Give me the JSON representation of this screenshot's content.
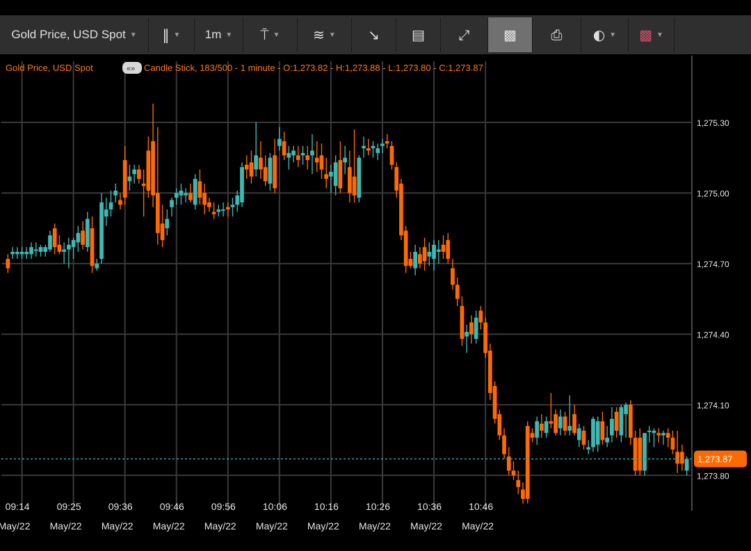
{
  "toolbar": {
    "instrument_label": "Gold Price, USD Spot",
    "interval_label": "1m",
    "icons": [
      "candle-type-icon",
      "chart-type-icon",
      "indicators-icon",
      "compare-icon",
      "drawing-icon",
      "fullscreen-icon",
      "bar-chart-icon",
      "print-icon",
      "theme-icon",
      "flag-icon"
    ]
  },
  "colors": {
    "up": "#3fb8b4",
    "down": "#ff6a00",
    "info_text": "#ff7a1a",
    "grid": "#3a3a3a",
    "axis_text": "#e6e6e6",
    "price_badge": "#ff6a00",
    "price_line": "#2fa3a6"
  },
  "info_line": {
    "name": "Gold Price, USD Spot",
    "badge": "«»",
    "details": "Candle Stick, 183/500 - 1 minute - O:1,273.82 - H:1,273.88 - L:1,273.80 - C:1,273.87"
  },
  "last_price_label": "1,273.87",
  "chart_data": {
    "type": "candlestick",
    "ylim": [
      1273.65,
      1275.56
    ],
    "y_ticks": [
      1275.3,
      1275.0,
      1274.7,
      1274.4,
      1274.1,
      1273.8
    ],
    "y_tick_labels": [
      "1,275.30",
      "1,275.00",
      "1,274.70",
      "1,274.40",
      "1,274.10",
      "1,273.80"
    ],
    "x_ticks": [
      {
        "index": 3,
        "time": "09:14",
        "date": "May/22"
      },
      {
        "index": 14,
        "time": "09:25",
        "date": "May/22"
      },
      {
        "index": 25,
        "time": "09:36",
        "date": "May/22"
      },
      {
        "index": 36,
        "time": "09:46",
        "date": "May/22"
      },
      {
        "index": 47,
        "time": "09:56",
        "date": "May/22"
      },
      {
        "index": 58,
        "time": "10:06",
        "date": "May/22"
      },
      {
        "index": 69,
        "time": "10:16",
        "date": "May/22"
      },
      {
        "index": 80,
        "time": "10:26",
        "date": "May/22"
      },
      {
        "index": 91,
        "time": "10:36",
        "date": "May/22"
      },
      {
        "index": 102,
        "time": "10:46",
        "date": "May/22"
      }
    ],
    "last_price": 1273.87,
    "ohlc": [
      [
        1274.72,
        1274.74,
        1274.66,
        1274.68
      ],
      [
        1274.74,
        1274.77,
        1274.72,
        1274.75
      ],
      [
        1274.74,
        1274.77,
        1274.72,
        1274.75
      ],
      [
        1274.74,
        1274.77,
        1274.72,
        1274.75
      ],
      [
        1274.74,
        1274.77,
        1274.72,
        1274.75
      ],
      [
        1274.74,
        1274.79,
        1274.72,
        1274.77
      ],
      [
        1274.76,
        1274.79,
        1274.73,
        1274.76
      ],
      [
        1274.75,
        1274.78,
        1274.73,
        1274.77
      ],
      [
        1274.75,
        1274.78,
        1274.73,
        1274.77
      ],
      [
        1274.76,
        1274.84,
        1274.75,
        1274.82
      ],
      [
        1274.85,
        1274.87,
        1274.74,
        1274.77
      ],
      [
        1274.78,
        1274.82,
        1274.74,
        1274.75
      ],
      [
        1274.75,
        1274.79,
        1274.7,
        1274.76
      ],
      [
        1274.76,
        1274.81,
        1274.68,
        1274.78
      ],
      [
        1274.77,
        1274.81,
        1274.72,
        1274.8
      ],
      [
        1274.79,
        1274.86,
        1274.75,
        1274.83
      ],
      [
        1274.84,
        1274.88,
        1274.76,
        1274.78
      ],
      [
        1274.77,
        1274.92,
        1274.75,
        1274.89
      ],
      [
        1274.85,
        1274.9,
        1274.66,
        1274.69
      ],
      [
        1274.68,
        1274.72,
        1274.67,
        1274.7
      ],
      [
        1274.72,
        1275.0,
        1274.7,
        1274.96
      ],
      [
        1274.9,
        1274.98,
        1274.86,
        1274.93
      ],
      [
        1274.93,
        1275.01,
        1274.9,
        1274.96
      ],
      [
        1274.99,
        1275.04,
        1274.96,
        1275.01
      ],
      [
        1274.97,
        1275.0,
        1274.93,
        1274.95
      ],
      [
        1275.14,
        1275.2,
        1274.95,
        1274.98
      ],
      [
        1275.05,
        1275.12,
        1275.01,
        1275.07
      ],
      [
        1275.08,
        1275.12,
        1275.04,
        1275.1
      ],
      [
        1275.1,
        1275.12,
        1275.04,
        1275.06
      ],
      [
        1275.04,
        1275.1,
        1274.9,
        1275.03
      ],
      [
        1275.18,
        1275.24,
        1274.98,
        1275.01
      ],
      [
        1275.22,
        1275.38,
        1274.94,
        1274.99
      ],
      [
        1275.0,
        1275.28,
        1274.78,
        1274.83
      ],
      [
        1274.87,
        1274.95,
        1274.77,
        1274.8
      ],
      [
        1274.85,
        1274.93,
        1274.82,
        1274.89
      ],
      [
        1274.94,
        1274.98,
        1274.9,
        1274.97
      ],
      [
        1274.98,
        1275.02,
        1274.95,
        1275.0
      ],
      [
        1274.99,
        1275.04,
        1274.95,
        1275.01
      ],
      [
        1274.99,
        1275.02,
        1274.96,
        1275.0
      ],
      [
        1275.0,
        1275.04,
        1274.96,
        1274.97
      ],
      [
        1274.95,
        1275.08,
        1274.93,
        1275.06
      ],
      [
        1275.05,
        1275.1,
        1274.95,
        1274.98
      ],
      [
        1275.0,
        1275.04,
        1274.91,
        1274.95
      ],
      [
        1274.96,
        1274.98,
        1274.92,
        1274.94
      ],
      [
        1274.92,
        1274.96,
        1274.89,
        1274.91
      ],
      [
        1274.92,
        1274.95,
        1274.9,
        1274.93
      ],
      [
        1274.93,
        1274.96,
        1274.9,
        1274.93
      ],
      [
        1274.94,
        1274.96,
        1274.9,
        1274.93
      ],
      [
        1274.94,
        1274.98,
        1274.9,
        1274.95
      ],
      [
        1274.95,
        1275.01,
        1274.92,
        1274.99
      ],
      [
        1274.96,
        1275.13,
        1274.94,
        1275.11
      ],
      [
        1275.12,
        1275.16,
        1275.06,
        1275.1
      ],
      [
        1275.13,
        1275.18,
        1275.04,
        1275.07
      ],
      [
        1275.1,
        1275.3,
        1275.07,
        1275.16
      ],
      [
        1275.15,
        1275.22,
        1275.06,
        1275.1
      ],
      [
        1275.11,
        1275.16,
        1275.03,
        1275.05
      ],
      [
        1275.04,
        1275.17,
        1275.01,
        1275.15
      ],
      [
        1275.16,
        1275.23,
        1275.0,
        1275.02
      ],
      [
        1275.2,
        1275.28,
        1275.18,
        1275.23
      ],
      [
        1275.22,
        1275.26,
        1275.14,
        1275.16
      ],
      [
        1275.15,
        1275.2,
        1275.1,
        1275.17
      ],
      [
        1275.16,
        1275.2,
        1275.13,
        1275.18
      ],
      [
        1275.16,
        1275.2,
        1275.11,
        1275.14
      ],
      [
        1275.16,
        1275.2,
        1275.12,
        1275.17
      ],
      [
        1275.16,
        1275.2,
        1275.1,
        1275.14
      ],
      [
        1275.16,
        1275.25,
        1275.08,
        1275.18
      ],
      [
        1275.15,
        1275.22,
        1275.09,
        1275.13
      ],
      [
        1275.16,
        1275.21,
        1275.06,
        1275.1
      ],
      [
        1275.08,
        1275.15,
        1275.02,
        1275.06
      ],
      [
        1275.07,
        1275.12,
        1275.0,
        1275.09
      ],
      [
        1275.03,
        1275.16,
        1274.99,
        1275.13
      ],
      [
        1275.14,
        1275.22,
        1275.0,
        1275.02
      ],
      [
        1275.13,
        1275.2,
        1275.08,
        1275.15
      ],
      [
        1275.11,
        1275.18,
        1274.96,
        1275.0
      ],
      [
        1275.07,
        1275.27,
        1274.96,
        1274.99
      ],
      [
        1274.98,
        1275.16,
        1274.96,
        1275.15
      ],
      [
        1275.19,
        1275.24,
        1275.15,
        1275.2
      ],
      [
        1275.19,
        1275.23,
        1275.16,
        1275.18
      ],
      [
        1275.19,
        1275.22,
        1275.15,
        1275.2
      ],
      [
        1275.17,
        1275.21,
        1275.14,
        1275.19
      ],
      [
        1275.2,
        1275.23,
        1275.17,
        1275.21
      ],
      [
        1275.22,
        1275.25,
        1275.19,
        1275.21
      ],
      [
        1275.2,
        1275.22,
        1275.1,
        1275.12
      ],
      [
        1275.11,
        1275.13,
        1274.98,
        1275.01
      ],
      [
        1275.04,
        1275.06,
        1274.8,
        1274.82
      ],
      [
        1274.84,
        1274.86,
        1274.66,
        1274.69
      ],
      [
        1274.72,
        1274.75,
        1274.68,
        1274.69
      ],
      [
        1274.68,
        1274.78,
        1274.65,
        1274.75
      ],
      [
        1274.74,
        1274.77,
        1274.68,
        1274.7
      ],
      [
        1274.77,
        1274.81,
        1274.67,
        1274.71
      ],
      [
        1274.73,
        1274.79,
        1274.69,
        1274.75
      ],
      [
        1274.72,
        1274.8,
        1274.67,
        1274.78
      ],
      [
        1274.75,
        1274.8,
        1274.7,
        1274.76
      ],
      [
        1274.78,
        1274.82,
        1274.72,
        1274.75
      ],
      [
        1274.8,
        1274.83,
        1274.7,
        1274.72
      ],
      [
        1274.68,
        1274.72,
        1274.59,
        1274.61
      ],
      [
        1274.61,
        1274.64,
        1274.52,
        1274.55
      ],
      [
        1274.52,
        1274.56,
        1274.35,
        1274.38
      ],
      [
        1274.39,
        1274.44,
        1274.32,
        1274.41
      ],
      [
        1274.45,
        1274.48,
        1274.36,
        1274.4
      ],
      [
        1274.38,
        1274.5,
        1274.36,
        1274.47
      ],
      [
        1274.5,
        1274.52,
        1274.42,
        1274.45
      ],
      [
        1274.45,
        1274.47,
        1274.3,
        1274.32
      ],
      [
        1274.33,
        1274.36,
        1274.12,
        1274.15
      ],
      [
        1274.18,
        1274.2,
        1274.02,
        1274.04
      ],
      [
        1274.06,
        1274.08,
        1273.95,
        1273.97
      ],
      [
        1273.97,
        1274.0,
        1273.87,
        1273.89
      ],
      [
        1273.88,
        1273.92,
        1273.8,
        1273.82
      ],
      [
        1273.82,
        1273.86,
        1273.78,
        1273.8
      ],
      [
        1273.78,
        1273.82,
        1273.72,
        1273.75
      ],
      [
        1273.74,
        1273.77,
        1273.68,
        1273.7
      ],
      [
        1274.01,
        1274.03,
        1273.68,
        1273.7
      ],
      [
        1273.98,
        1274.0,
        1273.94,
        1273.96
      ],
      [
        1273.96,
        1274.05,
        1273.93,
        1274.03
      ],
      [
        1274.02,
        1274.06,
        1273.96,
        1273.99
      ],
      [
        1273.98,
        1274.05,
        1273.96,
        1274.03
      ],
      [
        1274.03,
        1274.15,
        1274.0,
        1274.02
      ],
      [
        1274.06,
        1274.08,
        1273.97,
        1273.98
      ],
      [
        1274.0,
        1274.08,
        1273.97,
        1274.05
      ],
      [
        1274.05,
        1274.07,
        1273.97,
        1273.99
      ],
      [
        1273.99,
        1274.14,
        1273.97,
        1274.01
      ],
      [
        1274.06,
        1274.1,
        1273.97,
        1273.98
      ],
      [
        1273.95,
        1274.02,
        1273.92,
        1274.0
      ],
      [
        1273.99,
        1274.01,
        1273.91,
        1273.93
      ],
      [
        1273.91,
        1273.95,
        1273.89,
        1273.92
      ],
      [
        1273.92,
        1274.05,
        1273.9,
        1274.04
      ],
      [
        1273.93,
        1274.05,
        1273.9,
        1274.03
      ],
      [
        1274.03,
        1274.07,
        1273.93,
        1273.95
      ],
      [
        1273.94,
        1274.01,
        1273.92,
        1273.96
      ],
      [
        1273.97,
        1274.09,
        1273.94,
        1274.04
      ],
      [
        1274.07,
        1274.09,
        1273.96,
        1273.99
      ],
      [
        1273.97,
        1274.1,
        1273.94,
        1274.09
      ],
      [
        1274.06,
        1274.11,
        1273.96,
        1274.1
      ],
      [
        1274.1,
        1274.12,
        1273.93,
        1273.96
      ],
      [
        1273.96,
        1273.99,
        1273.8,
        1273.82
      ],
      [
        1273.96,
        1274.0,
        1273.8,
        1273.82
      ],
      [
        1273.82,
        1273.98,
        1273.8,
        1273.98
      ],
      [
        1273.99,
        1274.01,
        1273.94,
        1273.99
      ],
      [
        1273.98,
        1274.0,
        1273.92,
        1273.99
      ],
      [
        1273.98,
        1274.0,
        1273.94,
        1273.97
      ],
      [
        1273.97,
        1273.99,
        1273.93,
        1273.98
      ],
      [
        1273.98,
        1274.0,
        1273.92,
        1273.96
      ],
      [
        1273.96,
        1273.99,
        1273.89,
        1273.91
      ],
      [
        1273.9,
        1273.99,
        1273.81,
        1273.85
      ],
      [
        1273.9,
        1273.93,
        1273.82,
        1273.85
      ],
      [
        1273.82,
        1273.88,
        1273.8,
        1273.87
      ]
    ]
  }
}
